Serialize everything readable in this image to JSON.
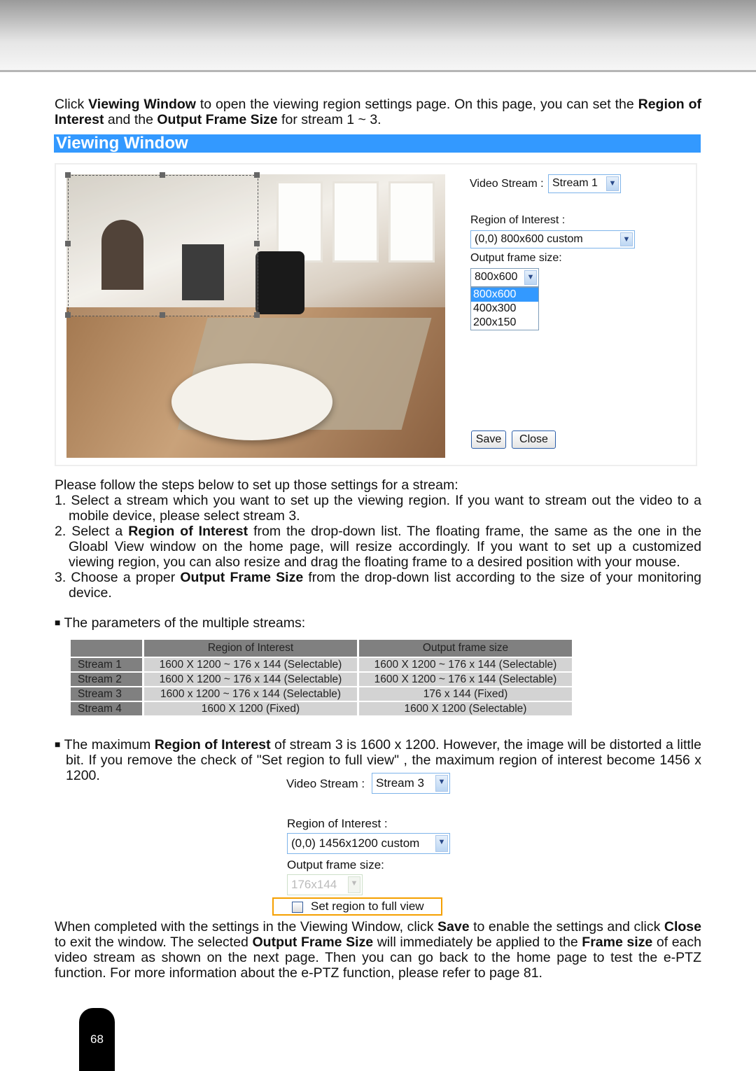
{
  "intro": {
    "p1": "Click ",
    "b1": "Viewing Window",
    "p2": " to open the viewing region settings page. On this page, you can set the ",
    "b2": "Region of Interest",
    "p3": " and the ",
    "b3": "Output Frame Size",
    "p4": " for stream 1 ~ 3."
  },
  "section_title": "Viewing Window",
  "panel": {
    "video_stream_label": "Video Stream :",
    "video_stream_value": "Stream 1",
    "roi_label": "Region of Interest :",
    "roi_value": "(0,0) 800x600 custom",
    "ofs_label": "Output frame size:",
    "ofs_value": "800x600",
    "ofs_options": [
      "800x600",
      "400x300",
      "200x150"
    ],
    "save": "Save",
    "close": "Close"
  },
  "steps": {
    "intro": "Please follow the steps below to set up those settings for a stream:",
    "s1": "1. Select a stream which you want to set up the viewing region. If you want to stream out the video to a mobile device, please select stream 3.",
    "s2a": "2. Select a ",
    "s2b": "Region of Interest",
    "s2c": " from the drop-down list. The floating frame, the same as the one in the Gloabl View window on the home page, will resize accordingly. If you want to set up a customized viewing region, you can also resize and drag the floating frame to a desired position with your mouse.",
    "s3a": "3. Choose a proper ",
    "s3b": "Output Frame Size",
    "s3c": " from the drop-down list according to the size of your monitoring device."
  },
  "params_heading": "The parameters of the multiple streams:",
  "table": {
    "headers": [
      "",
      "Region of Interest",
      "Output frame size"
    ],
    "rows": [
      [
        "Stream 1",
        "1600 X 1200 ~ 176 x 144 (Selectable)",
        "1600 X 1200 ~ 176 x 144 (Selectable)"
      ],
      [
        "Stream 2",
        "1600 X 1200 ~ 176 x 144 (Selectable)",
        "1600 X 1200 ~ 176 x 144 (Selectable)"
      ],
      [
        "Stream 3",
        "1600 x 1200 ~ 176 x 144 (Selectable)",
        "176 x 144 (Fixed)"
      ],
      [
        "Stream 4",
        "1600 X 1200 (Fixed)",
        "1600 X 1200 (Selectable)"
      ]
    ]
  },
  "max_note": {
    "a": "The maximum ",
    "b": "Region of Interest",
    "c": " of stream 3 is 1600 x 1200. However, the image will be distorted a little bit. If you remove the check of \"Set region to full view\" , the maximum region of interest become 1456 x 1200."
  },
  "panel2": {
    "video_stream_label": "Video Stream :",
    "video_stream_value": "Stream 3",
    "roi_label": "Region of Interest :",
    "roi_value": "(0,0) 1456x1200 custom",
    "ofs_label": "Output frame size:",
    "ofs_value": "176x144",
    "checkbox_label": "Set region to full view",
    "checkbox_checked": false
  },
  "closing": {
    "a": "When completed with the settings in the Viewing Window, click ",
    "b": "Save",
    "c": " to enable the settings and click ",
    "d": "Close",
    "e": " to exit the window. The selected ",
    "f": "Output Frame Size",
    "g": " will immediately be applied to the ",
    "h": "Frame size",
    "i": " of each video stream as shown on the next page. Then you can go back to the home page to test the e-PTZ function. For more information about the e-PTZ function, please refer to page 81."
  },
  "page_number": "68",
  "colors": {
    "banner": "#3399ff",
    "highlight": "#f5a000"
  }
}
